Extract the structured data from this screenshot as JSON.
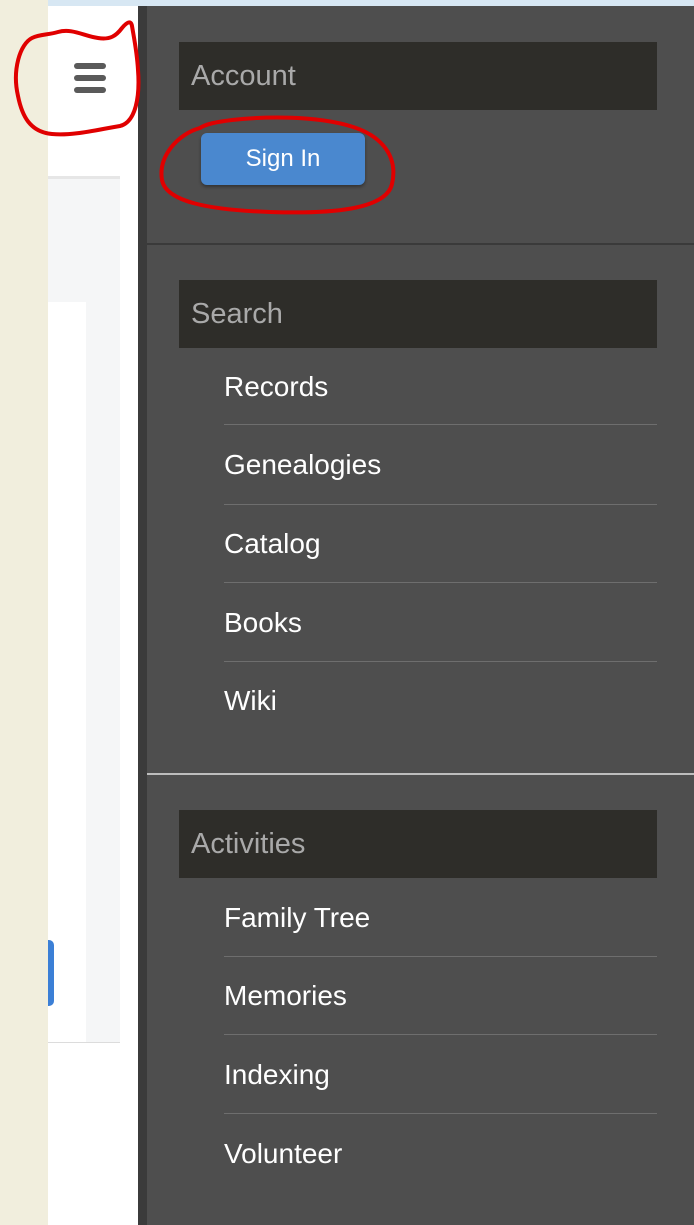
{
  "colors": {
    "page_background": "#f1eedd",
    "drawer_background": "#4e4e4e",
    "section_header_background": "#2e2d29",
    "section_header_text": "#a9a9a9",
    "sign_in_blue": "#4a88cf",
    "annotation_red": "#e00000"
  },
  "header": {
    "menu_icon": "hamburger-menu-icon"
  },
  "drawer": {
    "account": {
      "title": "Account",
      "sign_in_label": "Sign In"
    },
    "search": {
      "title": "Search",
      "items": [
        {
          "label": "Records"
        },
        {
          "label": "Genealogies"
        },
        {
          "label": "Catalog"
        },
        {
          "label": "Books"
        },
        {
          "label": "Wiki"
        }
      ]
    },
    "activities": {
      "title": "Activities",
      "items": [
        {
          "label": "Family Tree"
        },
        {
          "label": "Memories"
        },
        {
          "label": "Indexing"
        },
        {
          "label": "Volunteer"
        }
      ]
    }
  }
}
